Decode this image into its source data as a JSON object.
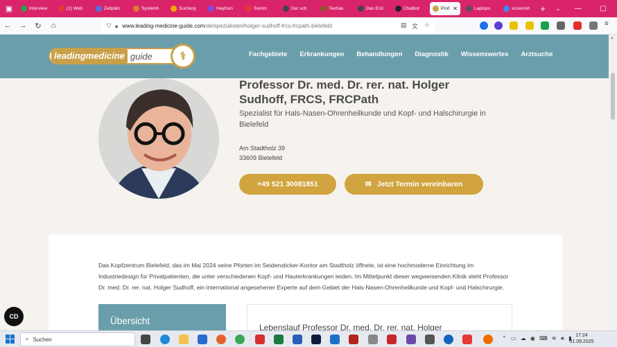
{
  "browser": {
    "tabs": [
      {
        "label": "Interview",
        "color": "#2e9e4c"
      },
      {
        "label": "(1) Web",
        "color": "#e53935"
      },
      {
        "label": "Zeitplän",
        "color": "#5b6ee1"
      },
      {
        "label": "Systemh",
        "color": "#e07a2d"
      },
      {
        "label": "Sucherg",
        "color": "#f2a900"
      },
      {
        "label": "HeyGen",
        "color": "#7b4ae2"
      },
      {
        "label": "Summ",
        "color": "#e53935"
      },
      {
        "label": "Der sch",
        "color": "#444"
      },
      {
        "label": "Tierhas",
        "color": "#8a5a2b"
      },
      {
        "label": "Das Erst",
        "color": "#444"
      },
      {
        "label": "Chatbot",
        "color": "#222"
      },
      {
        "label": "Prof.",
        "color": "#c9a04a",
        "active": true
      },
      {
        "label": "Laptops",
        "color": "#555"
      },
      {
        "label": "screensh",
        "color": "#4285f4"
      }
    ],
    "url_host": "www.leading-medicine-guide.com",
    "url_path": "/de/spezialisten/holger-sudhoff-frcs-frcpath-bielefeld"
  },
  "site": {
    "logo_text_1": "leadingmedicine",
    "logo_text_2": "guide",
    "nav": [
      "Fachgebiete",
      "Erkrankungen",
      "Behandlungen",
      "Diagnostik",
      "Wissenswertes",
      "Arztsuche"
    ]
  },
  "doctor": {
    "name": "Professor Dr. med. Dr. rer. nat. Holger Sudhoff, FRCS, FRCPath",
    "specialty": "Spezialist für Hals-Nasen-Ohrenheilkunde und Kopf- und Halschirurgie in Bielefeld",
    "street": "Am Stadtholz 39",
    "city": "33609 Bielefeld",
    "phone": "+49 521 30081851",
    "appointment_label": "Jetzt Termin vereinbaren"
  },
  "content": {
    "intro": "Das Kopfzentrum Bielefeld, das im Mai 2024 seine Pforten im Seidensticker-Kontor am Stadtholz öffnete, ist eine hochmoderne Einrichtung im Industriedesign für Privatpatienten, die unter verschiedenen Kopf- und Hauterkrankungen leiden. Im Mittelpunkt dieser wegweisenden Klinik steht Professor Dr. med. Dr. rer. nat. Holger Sudhoff, ein international angesehener Experte auf dem Gebiet der Hals-Nasen-Ohrenheilkunde und Kopf- und Halschirurgie.",
    "overview_label": "Übersicht",
    "cv_heading": "Lebenslauf Professor Dr. med. Dr. rer. nat. Holger"
  },
  "taskbar": {
    "search_placeholder": "Suchen",
    "time": "17:24",
    "date": "01.09.2025"
  }
}
